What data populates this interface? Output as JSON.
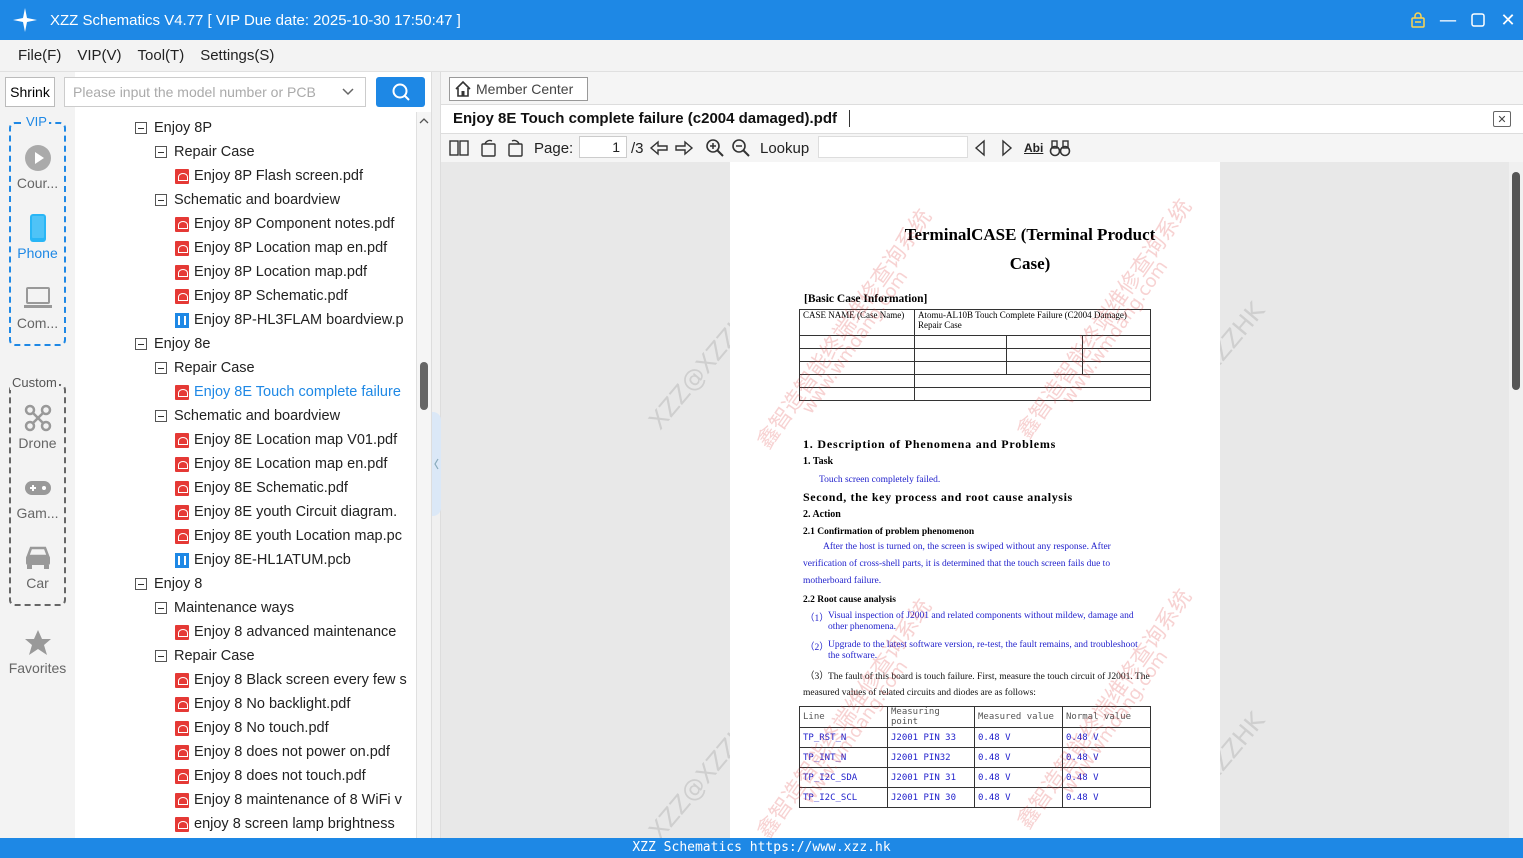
{
  "titlebar": {
    "title": "XZZ Schematics V4.77 [ VIP Due date: 2025-10-30 17:50:47 ]"
  },
  "menu": [
    "File(F)",
    "VIP(V)",
    "Tool(T)",
    "Settings(S)"
  ],
  "toolbar": {
    "shrink_label": "Shrink",
    "search_placeholder": "Please input the model number or PCB",
    "member_center": "Member Center"
  },
  "sidebar": {
    "vip_label": "VIP",
    "custom_label": "Custom",
    "items": [
      {
        "label": "Cour...",
        "icon": "play-icon"
      },
      {
        "label": "Phone",
        "icon": "phone-icon"
      },
      {
        "label": "Com...",
        "icon": "laptop-icon"
      },
      {
        "label": "Drone",
        "icon": "drone-icon"
      },
      {
        "label": "Gam...",
        "icon": "gamepad-icon"
      },
      {
        "label": "Car",
        "icon": "car-icon"
      },
      {
        "label": "Favorites",
        "icon": "star-icon"
      }
    ]
  },
  "tree": [
    {
      "level": 0,
      "type": "folder",
      "label": "Enjoy 8P"
    },
    {
      "level": 1,
      "type": "folder",
      "label": "Repair Case"
    },
    {
      "level": 2,
      "type": "pdf",
      "label": "Enjoy 8P Flash screen.pdf"
    },
    {
      "level": 1,
      "type": "folder",
      "label": "Schematic and boardview"
    },
    {
      "level": 2,
      "type": "pdf",
      "label": "Enjoy 8P Component notes.pdf"
    },
    {
      "level": 2,
      "type": "pdf",
      "label": "Enjoy 8P Location map en.pdf"
    },
    {
      "level": 2,
      "type": "pdf",
      "label": "Enjoy 8P Location map.pdf"
    },
    {
      "level": 2,
      "type": "pdf",
      "label": "Enjoy 8P Schematic.pdf"
    },
    {
      "level": 2,
      "type": "pcb",
      "label": "Enjoy 8P-HL3FLAM boardview.p"
    },
    {
      "level": 0,
      "type": "folder",
      "label": "Enjoy 8e"
    },
    {
      "level": 1,
      "type": "folder",
      "label": "Repair Case"
    },
    {
      "level": 2,
      "type": "pdf",
      "label": "Enjoy 8E Touch complete failure",
      "selected": true
    },
    {
      "level": 1,
      "type": "folder",
      "label": "Schematic and boardview"
    },
    {
      "level": 2,
      "type": "pdf",
      "label": "Enjoy 8E Location map V01.pdf"
    },
    {
      "level": 2,
      "type": "pdf",
      "label": "Enjoy 8E Location map en.pdf"
    },
    {
      "level": 2,
      "type": "pdf",
      "label": "Enjoy 8E Schematic.pdf"
    },
    {
      "level": 2,
      "type": "pdf",
      "label": "Enjoy 8E youth Circuit diagram."
    },
    {
      "level": 2,
      "type": "pdf",
      "label": "Enjoy 8E youth Location map.pc"
    },
    {
      "level": 2,
      "type": "pcb",
      "label": "Enjoy 8E-HL1ATUM.pcb"
    },
    {
      "level": 0,
      "type": "folder",
      "label": "Enjoy 8"
    },
    {
      "level": 1,
      "type": "folder",
      "label": "Maintenance ways"
    },
    {
      "level": 2,
      "type": "pdf",
      "label": "Enjoy 8 advanced maintenance"
    },
    {
      "level": 1,
      "type": "folder",
      "label": "Repair Case"
    },
    {
      "level": 2,
      "type": "pdf",
      "label": "Enjoy 8 Black screen every few s"
    },
    {
      "level": 2,
      "type": "pdf",
      "label": "Enjoy 8 No backlight.pdf"
    },
    {
      "level": 2,
      "type": "pdf",
      "label": "Enjoy 8 No touch.pdf"
    },
    {
      "level": 2,
      "type": "pdf",
      "label": "Enjoy 8 does not power on.pdf"
    },
    {
      "level": 2,
      "type": "pdf",
      "label": "Enjoy 8 does not touch.pdf"
    },
    {
      "level": 2,
      "type": "pdf",
      "label": "Enjoy 8 maintenance of 8 WiFi v"
    },
    {
      "level": 2,
      "type": "pdf",
      "label": "enjoy 8 screen lamp brightness"
    }
  ],
  "viewer": {
    "tab_title": "Enjoy 8E Touch complete failure (c2004 damaged).pdf",
    "page_label": "Page:",
    "page_current": "1",
    "page_total": "/3",
    "lookup_label": "Lookup"
  },
  "pdf": {
    "title_line1": "TerminalCASE (Terminal Product",
    "title_line2": "Case)",
    "basic_info": "[Basic Case Information]",
    "case_name_label": "CASE NAME (Case Name)",
    "case_name_value": "Atomu-AL10B Touch Complete Failure (C2004 Damage) Repair Case",
    "sec1": "1. Description of Phenomena and Problems",
    "task": "1. Task",
    "task_text": "Touch screen completely failed.",
    "sec2": "Second, the key process and root cause analysis",
    "action": "2. Action",
    "s21": "2.1  Confirmation of problem phenomenon",
    "s21_text1": "After the host is turned on, the screen is swiped without any response. After",
    "s21_text2": "verification of cross-shell parts, it is determined that the touch screen fails due to",
    "s21_text3": "motherboard failure.",
    "s22": "2.2  Root cause analysis",
    "r1_num": "（1）",
    "r1a": "Visual inspection of J2001 and related components without mildew, damage and",
    "r1b": "other phenomena.",
    "r2_num": "（2）",
    "r2a": "Upgrade to the latest software version, re-test, the fault remains, and troubleshoot",
    "r2b": "the software.",
    "r3_num": "（3）",
    "r3a": "The fault of this board is touch failure. First, measure the touch circuit of J2001. The",
    "r3b": "measured values of related circuits and diodes are as follows:",
    "meas_header": [
      "Line",
      "Measuring point",
      "Measured value",
      "Normal value"
    ],
    "meas_rows": [
      [
        "TP_RST_N",
        "J2001 PIN 33",
        "0.48 V",
        "0.48 V"
      ],
      [
        "TP_INT_N",
        "J2001 PIN32",
        "0.48 V",
        "0.48 V"
      ],
      [
        "TP_I2C_SDA",
        "J2001 PIN 31",
        "0.48 V",
        "0.48 V"
      ],
      [
        "TP_I2C_SCL",
        "J2001 PIN 30",
        "0.48 V",
        "0.48 V"
      ]
    ],
    "watermark_cn": "鑫智造智能终端维修查询系统",
    "watermark_url": "www.wmdang.com",
    "watermark_xzz": "XZZ@XZZHK"
  },
  "status": {
    "text": "XZZ Schematics https://www.xzz.hk"
  }
}
